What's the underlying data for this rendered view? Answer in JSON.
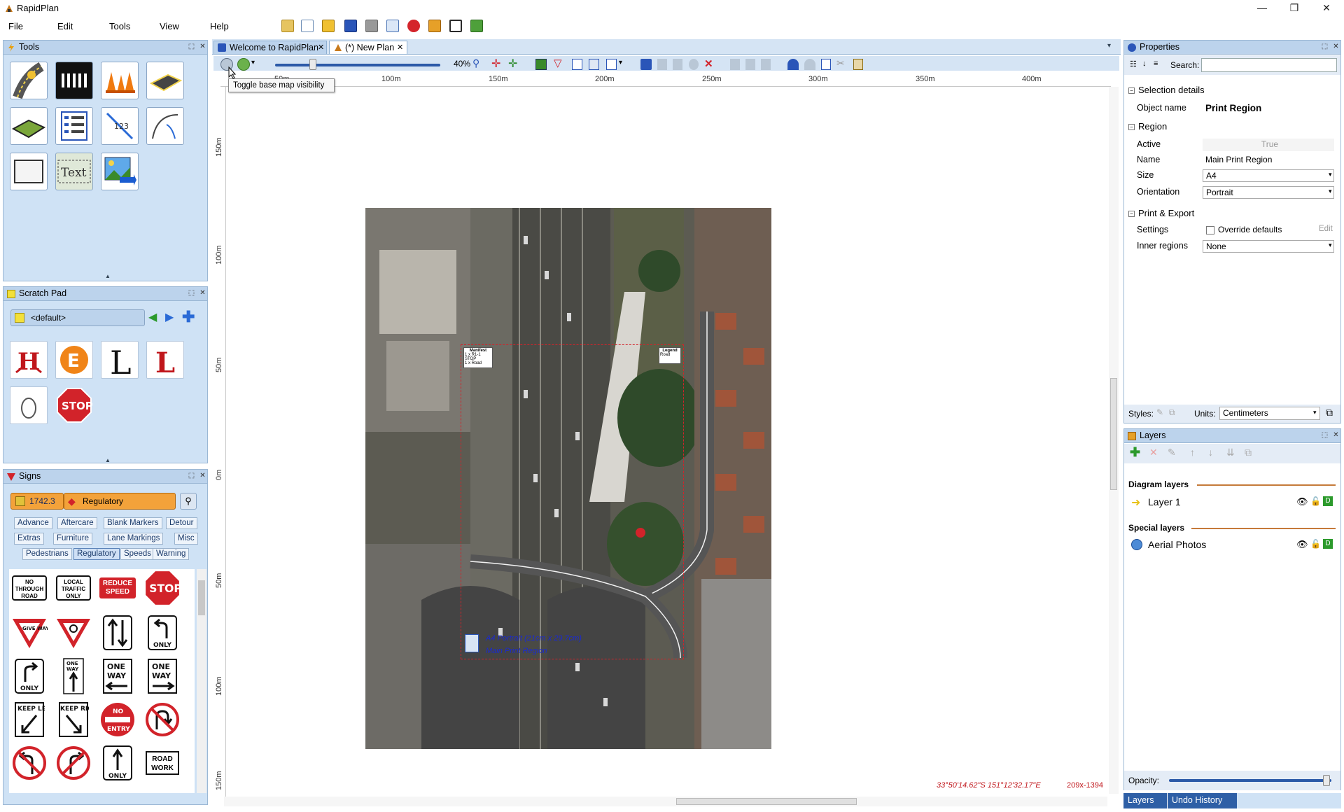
{
  "app": {
    "title": "RapidPlan"
  },
  "menu": [
    "File",
    "Edit",
    "Tools",
    "View",
    "Help"
  ],
  "tools_panel": {
    "title": "Tools"
  },
  "scratch_pad": {
    "title": "Scratch Pad",
    "selected": "<default>"
  },
  "signs_panel": {
    "title": "Signs",
    "standard": "1742.3",
    "category": "Regulatory",
    "filters": [
      "Advance",
      "Aftercare",
      "Blank Markers",
      "Detour",
      "Extras",
      "Furniture",
      "Lane Markings",
      "Misc",
      "Pedestrians",
      "Regulatory",
      "Speeds",
      "Warning"
    ],
    "active_filter": "Regulatory",
    "signs": {
      "no_through": "NO THROUGH ROAD",
      "local_traffic": "LOCAL TRAFFIC ONLY",
      "reduce_speed": "REDUCE SPEED",
      "stop": "STOP",
      "give_way": "GIVE WAY",
      "only": "ONLY",
      "one": "ONE",
      "way": "WAY",
      "keep_left": "KEEP LEFT",
      "keep_right": "KEEP RIGHT",
      "no_entry_1": "NO",
      "no_entry_2": "ENTRY",
      "road_work": "ROAD WORK"
    }
  },
  "tabs": [
    {
      "label": "Welcome to RapidPlan"
    },
    {
      "label": "(*) New Plan"
    }
  ],
  "canvas_toolbar": {
    "zoom": "40%",
    "tooltip": "Toggle base map visibility"
  },
  "ruler": {
    "h": [
      "50m",
      "100m",
      "150m",
      "200m",
      "250m",
      "300m",
      "350m",
      "400m"
    ],
    "v": [
      "150m",
      "100m",
      "50m",
      "0m",
      "50m",
      "100m",
      "150m"
    ]
  },
  "plan": {
    "manifest_title": "Manifest",
    "manifest_line1": "1 x  R1-1 STOP",
    "manifest_line2": "1 x  Road",
    "legend_title": "Legend",
    "legend_line1": "Road",
    "region_line1": "A4 Portrait (21cm x 29.7cm)",
    "region_line2": "Main Print Region"
  },
  "status": {
    "coords": "33°50'14.62\"S 151°12'32.17\"E",
    "size": "209x-1394"
  },
  "properties": {
    "title": "Properties",
    "search_label": "Search:",
    "sections": {
      "selection": "Selection details",
      "region": "Region",
      "print": "Print & Export"
    },
    "object_name_label": "Object name",
    "object_name": "Print Region",
    "active_label": "Active",
    "active_value": "True",
    "name_label": "Name",
    "name_value": "Main Print Region",
    "size_label": "Size",
    "size_value": "A4",
    "orientation_label": "Orientation",
    "orientation_value": "Portrait",
    "settings_label": "Settings",
    "override_label": "Override defaults",
    "edit_label": "Edit",
    "inner_label": "Inner regions",
    "inner_value": "None",
    "styles_label": "Styles:",
    "units_label": "Units:",
    "units_value": "Centimeters"
  },
  "layers": {
    "title": "Layers",
    "diagram_heading": "Diagram layers",
    "special_heading": "Special layers",
    "items": [
      {
        "name": "Layer 1"
      },
      {
        "name": "Aerial Photos"
      }
    ],
    "opacity_label": "Opacity:",
    "opacity": 0.97
  },
  "bottom_tabs": [
    "Layers",
    "Undo History"
  ]
}
